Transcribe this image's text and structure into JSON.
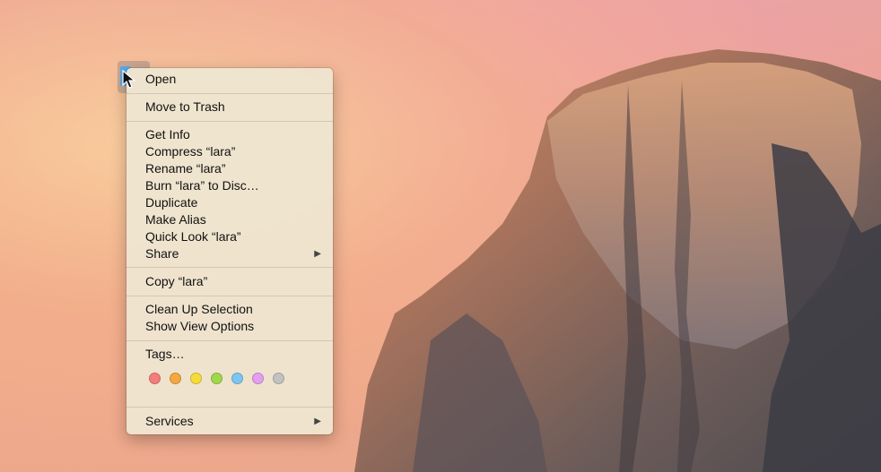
{
  "menu": {
    "items": [
      {
        "id": "open",
        "label": "Open"
      },
      {
        "id": "move-to-trash",
        "label": "Move to Trash"
      },
      {
        "id": "get-info",
        "label": "Get Info"
      },
      {
        "id": "compress",
        "label": "Compress “lara”"
      },
      {
        "id": "rename",
        "label": "Rename “lara”"
      },
      {
        "id": "burn",
        "label": "Burn “lara” to Disc…"
      },
      {
        "id": "duplicate",
        "label": "Duplicate"
      },
      {
        "id": "make-alias",
        "label": "Make Alias"
      },
      {
        "id": "quick-look",
        "label": "Quick Look “lara”"
      },
      {
        "id": "share",
        "label": "Share",
        "submenu": true
      },
      {
        "id": "copy",
        "label": "Copy “lara”"
      },
      {
        "id": "clean-up",
        "label": "Clean Up Selection"
      },
      {
        "id": "show-view-options",
        "label": "Show View Options"
      },
      {
        "id": "tags",
        "label": "Tags…"
      },
      {
        "id": "services",
        "label": "Services",
        "submenu": true
      }
    ],
    "tag_colors": [
      "#f47c7c",
      "#f5a742",
      "#f5dc3a",
      "#9fd84a",
      "#7cc6f2",
      "#e49ff0",
      "#c2c2c2"
    ]
  },
  "icons": {
    "submenu_arrow": "triangle-right-icon",
    "cursor": "mouse-pointer-icon",
    "desktop_item": "folder-icon"
  }
}
